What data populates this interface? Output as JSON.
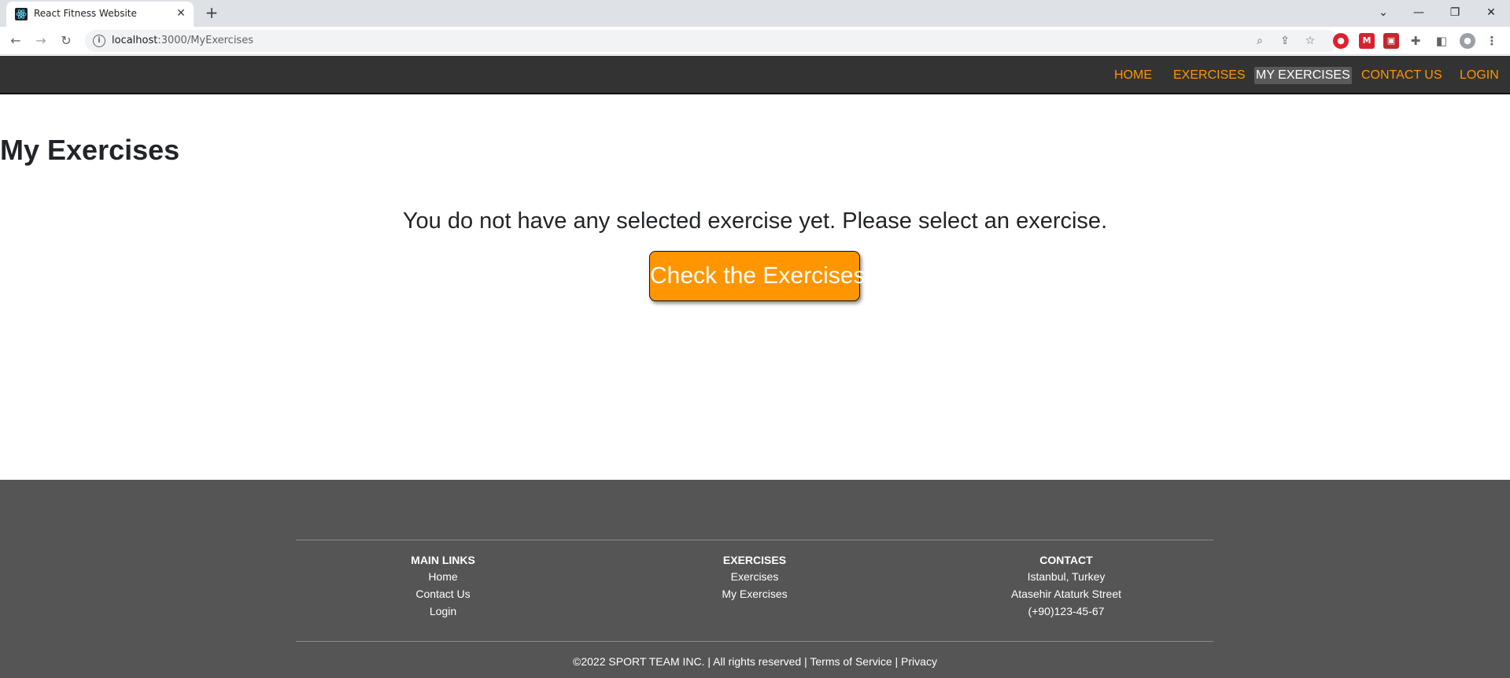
{
  "browser": {
    "tab_title": "React Fitness Website",
    "url_host": "localhost",
    "url_path": ":3000/MyExercises"
  },
  "navbar": {
    "links": [
      "HOME",
      "EXERCISES",
      "MY EXERCISES",
      "CONTACT US",
      "LOGIN"
    ],
    "active": "MY EXERCISES",
    "accent_color": "#ff9500"
  },
  "main": {
    "page_title": "My Exercises",
    "empty_message": "You do not have any selected exercise yet. Please select an exercise.",
    "cta_label": "Check the Exercises"
  },
  "footer": {
    "main_links": {
      "heading": "MAIN LINKS",
      "items": [
        "Home",
        "Contact Us",
        "Login"
      ]
    },
    "exercises": {
      "heading": "EXERCISES",
      "items": [
        "Exercises",
        "My Exercises"
      ]
    },
    "contact": {
      "heading": "CONTACT",
      "items": [
        "Istanbul, Turkey",
        "Atasehir Ataturk Street",
        "(+90)123-45-67"
      ]
    },
    "copyright": "©2022 SPORT TEAM INC. | All rights reserved | Terms of Service | Privacy"
  },
  "colors": {
    "navbar_bg": "#333333",
    "footer_bg": "#555555",
    "cta_bg": "#ff9500"
  }
}
